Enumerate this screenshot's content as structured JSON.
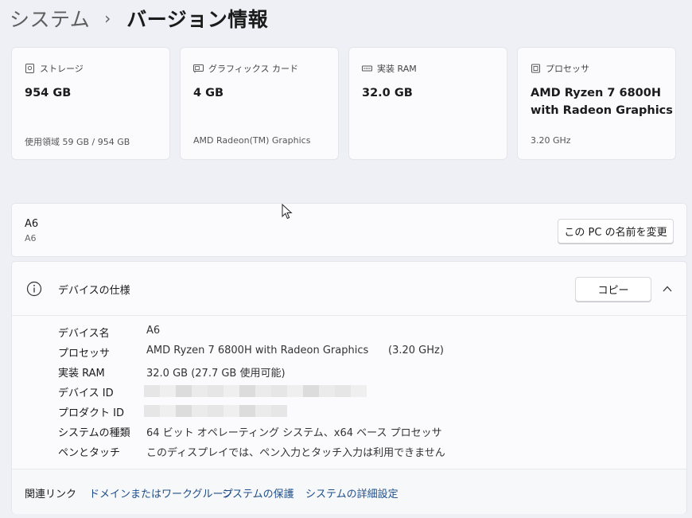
{
  "breadcrumb": {
    "parent": "システム",
    "separator": "›",
    "current": "バージョン情報"
  },
  "cards": [
    {
      "icon": "storage-icon",
      "label": "ストレージ",
      "value": "954 GB",
      "sub": "使用領域 59 GB / 954 GB"
    },
    {
      "icon": "graphics-card-icon",
      "label": "グラフィックス カード",
      "value": "4 GB",
      "sub": "AMD Radeon(TM) Graphics"
    },
    {
      "icon": "memory-icon",
      "label": "実装 RAM",
      "value": "32.0 GB",
      "sub": ""
    },
    {
      "icon": "processor-icon",
      "label": "プロセッサ",
      "value_line1": "AMD Ryzen 7 6800H",
      "value_line2": "with Radeon Graphics",
      "sub": "3.20 GHz"
    }
  ],
  "device": {
    "name": "A6",
    "model": "A6",
    "rename_button": "この PC の名前を変更"
  },
  "specs": {
    "title": "デバイスの仕様",
    "copy_button": "コピー",
    "rows": [
      {
        "key": "デバイス名",
        "value": "A6"
      },
      {
        "key": "プロセッサ",
        "value": "AMD Ryzen 7 6800H with Radeon Graphics",
        "extra": "(3.20 GHz)"
      },
      {
        "key": "実装 RAM",
        "value": "32.0 GB (27.7 GB 使用可能)"
      },
      {
        "key": "デバイス ID",
        "value": ""
      },
      {
        "key": "プロダクト ID",
        "value": ""
      },
      {
        "key": "システムの種類",
        "value": "64 ビット オペレーティング システム、x64 ベース プロセッサ"
      },
      {
        "key": "ペンとタッチ",
        "value": "このディスプレイでは、ペン入力とタッチ入力は利用できません"
      }
    ]
  },
  "related": {
    "label": "関連リンク",
    "links": [
      "ドメインまたはワークグループ",
      "システムの保護",
      "システムの詳細設定"
    ]
  },
  "colors": {
    "background": "#eef0f6",
    "card": "#fbfbfd",
    "link": "#1f4f8b"
  }
}
